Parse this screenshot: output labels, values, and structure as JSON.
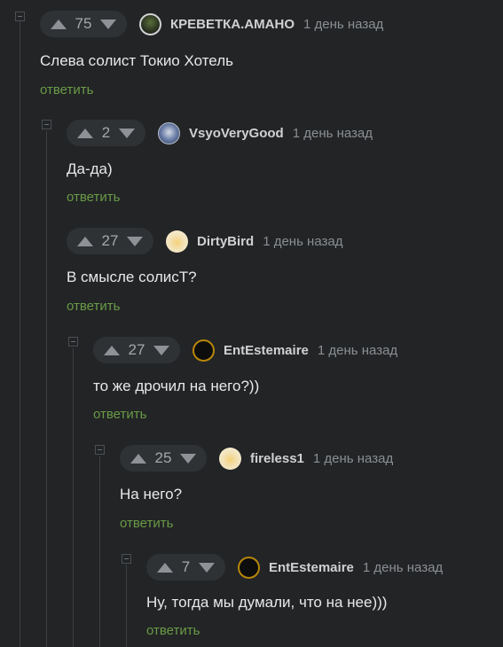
{
  "comments": [
    {
      "score": "75",
      "username": "КРЕВЕТКА.АМАНО",
      "time": "1 день назад",
      "text": "Слева солист Токио Хотель",
      "reply": "ответить",
      "avatar_icon": "avatar-dark-landscape"
    },
    {
      "score": "2",
      "username": "VsyoVeryGood",
      "time": "1 день назад",
      "text": "Да-да)",
      "reply": "ответить",
      "avatar_icon": "avatar-blue-figure"
    },
    {
      "score": "27",
      "username": "DirtyBird",
      "time": "1 день назад",
      "text": "В смысле солисТ?",
      "reply": "ответить",
      "avatar_icon": "avatar-cream-bird"
    },
    {
      "score": "27",
      "username": "EntEstemaire",
      "time": "1 день назад",
      "text": "то же дрочил на него?))",
      "reply": "ответить",
      "avatar_icon": "avatar-black-gold-ring"
    },
    {
      "score": "25",
      "username": "fireless1",
      "time": "1 день назад",
      "text": "На него?",
      "reply": "ответить",
      "avatar_icon": "avatar-cream-bird"
    },
    {
      "score": "7",
      "username": "EntEstemaire",
      "time": "1 день назад",
      "text": "Ну, тогда мы думали, что на нее)))",
      "reply": "ответить",
      "avatar_icon": "avatar-black-gold-ring"
    }
  ],
  "colors": {
    "background": "#222426",
    "reply_link": "#6a9b46",
    "thread_line": "#3d4043"
  }
}
